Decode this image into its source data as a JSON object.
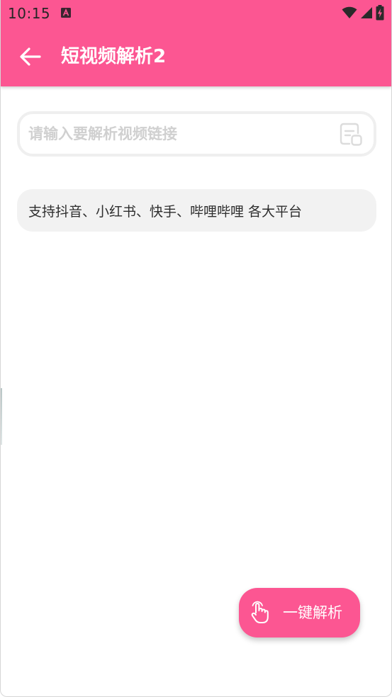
{
  "status_bar": {
    "time": "10:15",
    "notification_icon": "a-badge-icon",
    "wifi_icon": "wifi-icon",
    "signal_icon": "cell-signal-icon",
    "battery_icon": "battery-charging-icon"
  },
  "toolbar": {
    "title": "短视频解析2",
    "back_icon": "arrow-left-icon"
  },
  "search": {
    "value": "",
    "placeholder": "请输入要解析视频链接",
    "paste_icon": "clipboard-paste-icon"
  },
  "info": {
    "text": "支持抖音、小红书、快手、哔哩哔哩 各大平台"
  },
  "action": {
    "label": "一键解析",
    "icon": "hand-pointer-icon"
  },
  "colors": {
    "accent": "#fc5692",
    "card_bg": "#f2f2f2",
    "input_border": "#efefef",
    "placeholder": "#d0d0d0"
  }
}
